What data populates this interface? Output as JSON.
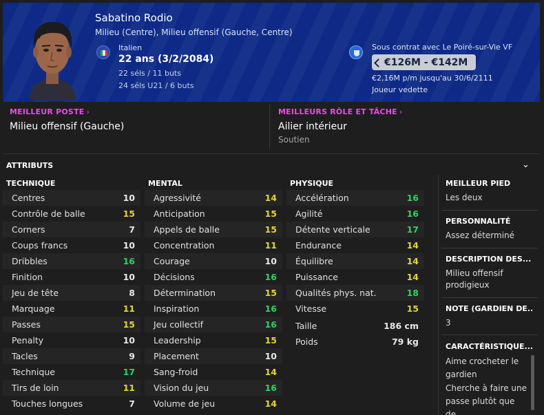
{
  "player": {
    "name": "Sabatino Rodio",
    "positions": "Milieu (Centre), Milieu offensif (Gauche, Centre)",
    "nationality": "Italien",
    "age": "22 ans (3/2/2084)",
    "caps": "22 séls / 11 buts",
    "caps_u21": "24 séls U21 / 6 buts",
    "contract": "Sous contrat avec Le Poiré-sur-Vie VF",
    "value": "€126M - €142M",
    "wage": "€2,16M p/m jusqu'au 30/6/2111",
    "squad_role": "Joueur vedette"
  },
  "best_position": {
    "title": "MEILLEUR POSTE",
    "value": "Milieu offensif (Gauche)"
  },
  "best_role": {
    "title": "MEILLEURS RÔLE ET TÂCHE",
    "value": "Ailier intérieur",
    "duty": "Soutien"
  },
  "attributes_label": "ATTRIBUTS",
  "technical": {
    "title": "TECHNIQUE",
    "rows": [
      {
        "name": "Centres",
        "value": "10"
      },
      {
        "name": "Contrôle de balle",
        "value": "15"
      },
      {
        "name": "Corners",
        "value": "7"
      },
      {
        "name": "Coups francs",
        "value": "10"
      },
      {
        "name": "Dribbles",
        "value": "16"
      },
      {
        "name": "Finition",
        "value": "10"
      },
      {
        "name": "Jeu de tête",
        "value": "8"
      },
      {
        "name": "Marquage",
        "value": "11"
      },
      {
        "name": "Passes",
        "value": "15"
      },
      {
        "name": "Penalty",
        "value": "10"
      },
      {
        "name": "Tacles",
        "value": "9"
      },
      {
        "name": "Technique",
        "value": "17"
      },
      {
        "name": "Tirs de loin",
        "value": "11"
      },
      {
        "name": "Touches longues",
        "value": "7"
      }
    ]
  },
  "mental": {
    "title": "MENTAL",
    "rows": [
      {
        "name": "Agressivité",
        "value": "14"
      },
      {
        "name": "Anticipation",
        "value": "15"
      },
      {
        "name": "Appels de balle",
        "value": "15"
      },
      {
        "name": "Concentration",
        "value": "11"
      },
      {
        "name": "Courage",
        "value": "10"
      },
      {
        "name": "Décisions",
        "value": "16"
      },
      {
        "name": "Détermination",
        "value": "15"
      },
      {
        "name": "Inspiration",
        "value": "16"
      },
      {
        "name": "Jeu collectif",
        "value": "16"
      },
      {
        "name": "Leadership",
        "value": "15"
      },
      {
        "name": "Placement",
        "value": "10"
      },
      {
        "name": "Sang-froid",
        "value": "14"
      },
      {
        "name": "Vision du jeu",
        "value": "16"
      },
      {
        "name": "Volume de jeu",
        "value": "14"
      }
    ]
  },
  "physical": {
    "title": "PHYSIQUE",
    "rows": [
      {
        "name": "Accélération",
        "value": "16"
      },
      {
        "name": "Agilité",
        "value": "16"
      },
      {
        "name": "Détente verticale",
        "value": "17"
      },
      {
        "name": "Endurance",
        "value": "14"
      },
      {
        "name": "Équilibre",
        "value": "14"
      },
      {
        "name": "Puissance",
        "value": "14"
      },
      {
        "name": "Qualités phys. nat.",
        "value": "18"
      },
      {
        "name": "Vitesse",
        "value": "15"
      }
    ],
    "height_label": "Taille",
    "height": "186 cm",
    "weight_label": "Poids",
    "weight": "79 kg"
  },
  "side": {
    "foot_title": "MEILLEUR PIED",
    "foot": "Les deux",
    "personality_title": "PERSONNALITÉ",
    "personality": "Assez déterminé",
    "description_title": "DESCRIPTION DES...",
    "description": "Milieu offensif prodigieux",
    "gk_title": "NOTE (GARDIEN DE...",
    "gk": "3",
    "traits_title": "CARACTÉRISTIQUE...",
    "trait1": "Aime crocheter le gardien",
    "trait2": "Cherche à faire une passe plutôt que de"
  },
  "colors": {
    "header_bg": "#0e2a86",
    "accent_magenta": "#e64ee6",
    "value_high": "#2fd35c",
    "value_mid": "#e6d23a",
    "value_low": "#e8e8e8"
  }
}
